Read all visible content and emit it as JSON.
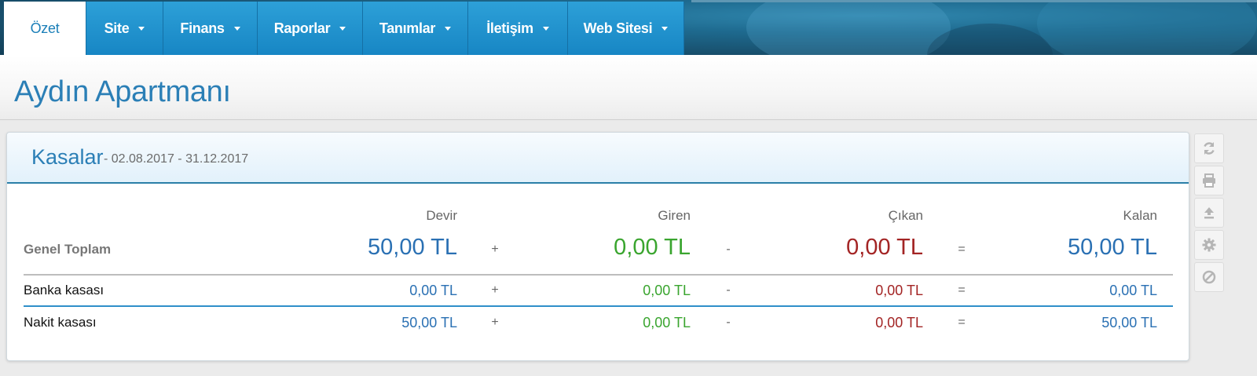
{
  "nav": {
    "items": [
      {
        "label": "Özet",
        "active": true
      },
      {
        "label": "Site",
        "dropdown": true
      },
      {
        "label": "Finans",
        "dropdown": true
      },
      {
        "label": "Raporlar",
        "dropdown": true
      },
      {
        "label": "Tanımlar",
        "dropdown": true
      },
      {
        "label": "İletişim",
        "dropdown": true
      },
      {
        "label": "Web Sitesi",
        "dropdown": true
      }
    ]
  },
  "page": {
    "title": "Aydın Apartmanı"
  },
  "panel": {
    "title": "Kasalar",
    "subtitle": "- 02.08.2017 - 31.12.2017",
    "columns": {
      "devir": "Devir",
      "giren": "Giren",
      "cikan": "Çıkan",
      "kalan": "Kalan"
    },
    "operators": {
      "plus": "+",
      "minus": "-",
      "equals": "="
    },
    "total": {
      "label": "Genel Toplam",
      "devir": "50,00 TL",
      "giren": "0,00 TL",
      "cikan": "0,00 TL",
      "kalan": "50,00 TL"
    },
    "rows": [
      {
        "label": "Banka kasası",
        "devir": "0,00 TL",
        "giren": "0,00 TL",
        "cikan": "0,00 TL",
        "kalan": "0,00 TL"
      },
      {
        "label": "Nakit kasası",
        "devir": "50,00 TL",
        "giren": "0,00 TL",
        "cikan": "0,00 TL",
        "kalan": "50,00 TL"
      }
    ]
  },
  "tools": [
    "refresh-icon",
    "print-icon",
    "export-icon",
    "gear-icon",
    "disable-icon"
  ],
  "colors": {
    "accent": "#1b7fb8",
    "devir": "#2a70b3",
    "giren": "#3aa52f",
    "cikan": "#a32424",
    "kalan": "#2a70b3"
  }
}
